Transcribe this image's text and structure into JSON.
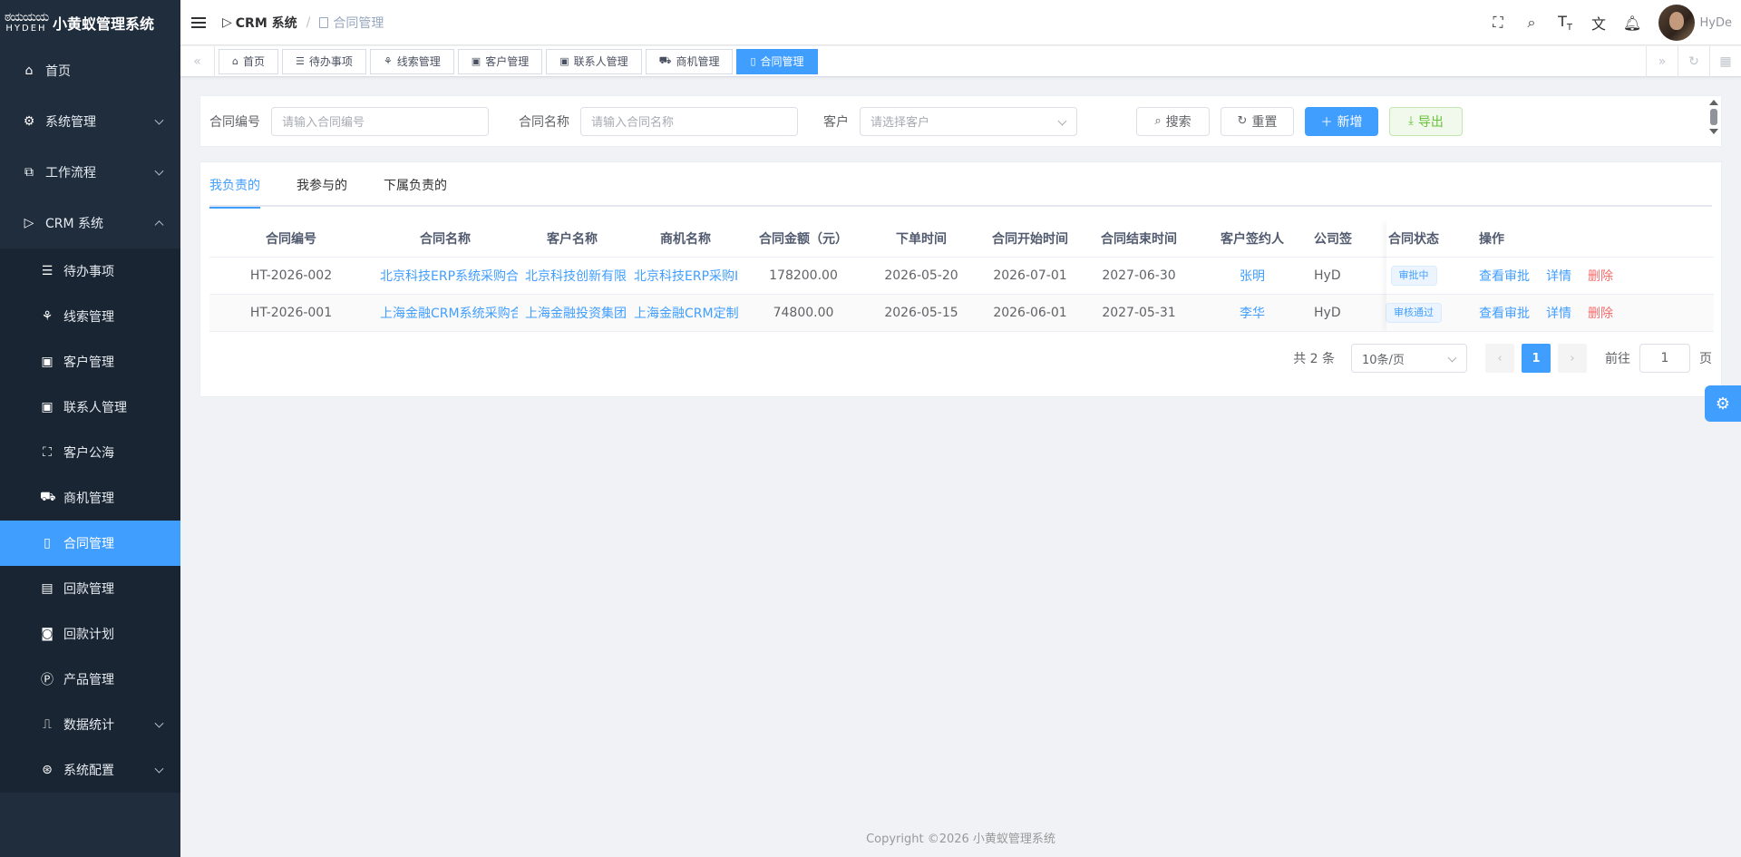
{
  "app": {
    "logo_glyph": "ಠಯಯಯ",
    "logo_word": "HYDEH",
    "title": "小黄蚁管理系统"
  },
  "sidebar": {
    "items": [
      {
        "label": "首页",
        "icon": "home-icon",
        "glyph": "⌂"
      },
      {
        "label": "系统管理",
        "icon": "gear-icon",
        "glyph": "⚙"
      },
      {
        "label": "工作流程",
        "icon": "workflow-icon",
        "glyph": "⧉"
      },
      {
        "label": "CRM 系统",
        "icon": "crm-icon",
        "glyph": "▷"
      }
    ],
    "crm_children": [
      {
        "label": "待办事项",
        "icon": "todo-list-icon",
        "glyph": "☰"
      },
      {
        "label": "线索管理",
        "icon": "clue-icon",
        "glyph": "⚘"
      },
      {
        "label": "客户管理",
        "icon": "customer-icon",
        "glyph": "▣"
      },
      {
        "label": "联系人管理",
        "icon": "contact-icon",
        "glyph": "▣"
      },
      {
        "label": "客户公海",
        "icon": "pool-icon",
        "glyph": "⛶"
      },
      {
        "label": "商机管理",
        "icon": "opportunity-icon",
        "glyph": "⛟"
      },
      {
        "label": "合同管理",
        "icon": "contract-icon",
        "glyph": "▯",
        "active": true
      },
      {
        "label": "回款管理",
        "icon": "payment-icon",
        "glyph": "▤"
      },
      {
        "label": "回款计划",
        "icon": "payment-plan-icon",
        "glyph": "◙"
      },
      {
        "label": "产品管理",
        "icon": "product-icon",
        "glyph": "Ⓟ"
      },
      {
        "label": "数据统计",
        "icon": "stats-icon",
        "glyph": "⎍"
      },
      {
        "label": "系统配置",
        "icon": "config-icon",
        "glyph": "⊛"
      }
    ]
  },
  "header": {
    "breadcrumb_root": "CRM 系统",
    "breadcrumb_sep": "/",
    "breadcrumb_current": "合同管理",
    "user_name": "HyDe"
  },
  "tags": [
    {
      "label": "首页",
      "glyph": "⌂"
    },
    {
      "label": "待办事项",
      "glyph": "☰"
    },
    {
      "label": "线索管理",
      "glyph": "⚘"
    },
    {
      "label": "客户管理",
      "glyph": "▣"
    },
    {
      "label": "联系人管理",
      "glyph": "▣"
    },
    {
      "label": "商机管理",
      "glyph": "⛟"
    },
    {
      "label": "合同管理",
      "glyph": "▯",
      "active": true
    }
  ],
  "search": {
    "contract_no_label": "合同编号",
    "contract_no_placeholder": "请输入合同编号",
    "contract_name_label": "合同名称",
    "contract_name_placeholder": "请输入合同名称",
    "customer_label": "客户",
    "customer_placeholder": "请选择客户",
    "search_btn": "搜索",
    "reset_btn": "重置",
    "add_btn": "新增",
    "export_btn": "导出"
  },
  "tabs": [
    "我负责的",
    "我参与的",
    "下属负责的"
  ],
  "table": {
    "columns": [
      "合同编号",
      "合同名称",
      "客户名称",
      "商机名称",
      "合同金额（元）",
      "下单时间",
      "合同开始时间",
      "合同结束时间",
      "客户签约人",
      "公司签",
      "合同状态",
      "操作"
    ],
    "rows": [
      {
        "no": "HT-2026-002",
        "name": "北京科技ERP系统采购合",
        "customer": "北京科技创新有限",
        "opportunity": "北京科技ERP采购I",
        "amount": "178200.00",
        "order_date": "2026-05-20",
        "start": "2026-07-01",
        "end": "2027-06-30",
        "signer": "张明",
        "company_signer": "HyD",
        "status": "审批中"
      },
      {
        "no": "HT-2026-001",
        "name": "上海金融CRM系统采购合",
        "customer": "上海金融投资集团",
        "opportunity": "上海金融CRM定制",
        "amount": "74800.00",
        "order_date": "2026-05-15",
        "start": "2026-06-01",
        "end": "2027-05-31",
        "signer": "李华",
        "company_signer": "HyD",
        "status": "审核通过"
      }
    ],
    "ops": {
      "view": "查看审批",
      "detail": "详情",
      "delete": "删除"
    }
  },
  "pager": {
    "total": "共 2 条",
    "size": "10条/页",
    "current": "1",
    "goto_label": "前往",
    "goto_value": "1",
    "page_suffix": "页"
  },
  "footer": "Copyright ©2026 小黄蚁管理系统"
}
